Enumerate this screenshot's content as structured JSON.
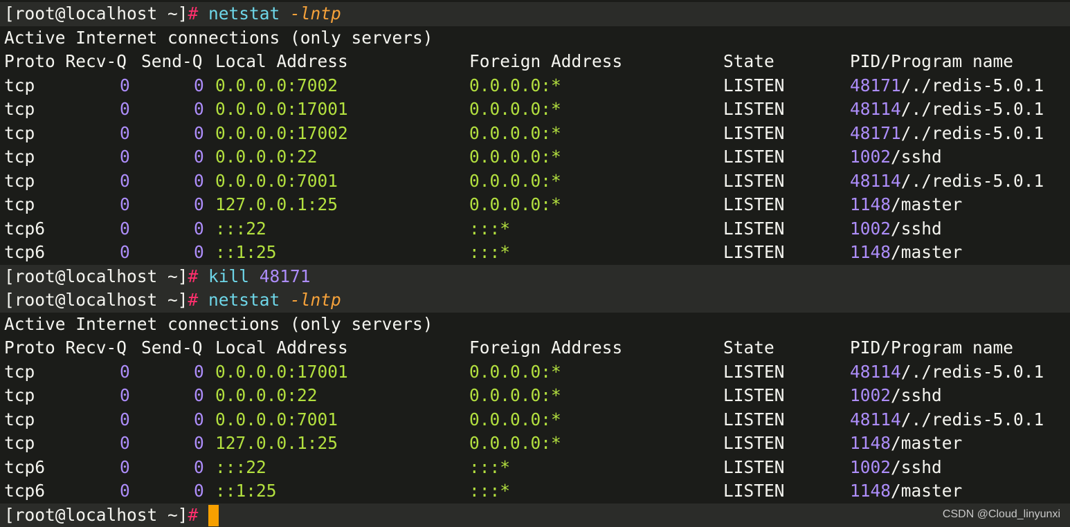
{
  "colors": {
    "background": "#1b1c19",
    "prompt_band": "#2b2c29",
    "text": "#f5f5f0",
    "number": "#ad8dfa",
    "address": "#b3e03f",
    "command": "#6ed6e8",
    "option": "#f6a23a",
    "prompt_hash": "#ff2f6d",
    "cursor": "#f7a000"
  },
  "prompt": {
    "text": "[root@localhost ~]",
    "symbol": "#"
  },
  "commands": [
    {
      "command": "netstat",
      "argument": "-lntp"
    },
    {
      "command": "kill",
      "argument": "48171"
    },
    {
      "command": "netstat",
      "argument": "-lntp"
    }
  ],
  "outputs": [
    {
      "heading": "Active Internet connections (only servers)",
      "columns": {
        "proto_recv": "Proto Recv-Q",
        "send": "Send-Q",
        "local": "Local Address",
        "foreign": "Foreign Address",
        "state": "State",
        "pid": "PID/Program name"
      },
      "rows": [
        {
          "proto": "tcp",
          "recv_q": "0",
          "send_q": "0",
          "local": "0.0.0.0:7002",
          "foreign": "0.0.0.0:*",
          "state": "LISTEN",
          "pid": "48171",
          "program": "/./redis-5.0.1"
        },
        {
          "proto": "tcp",
          "recv_q": "0",
          "send_q": "0",
          "local": "0.0.0.0:17001",
          "foreign": "0.0.0.0:*",
          "state": "LISTEN",
          "pid": "48114",
          "program": "/./redis-5.0.1"
        },
        {
          "proto": "tcp",
          "recv_q": "0",
          "send_q": "0",
          "local": "0.0.0.0:17002",
          "foreign": "0.0.0.0:*",
          "state": "LISTEN",
          "pid": "48171",
          "program": "/./redis-5.0.1"
        },
        {
          "proto": "tcp",
          "recv_q": "0",
          "send_q": "0",
          "local": "0.0.0.0:22",
          "foreign": "0.0.0.0:*",
          "state": "LISTEN",
          "pid": "1002",
          "program": "/sshd"
        },
        {
          "proto": "tcp",
          "recv_q": "0",
          "send_q": "0",
          "local": "0.0.0.0:7001",
          "foreign": "0.0.0.0:*",
          "state": "LISTEN",
          "pid": "48114",
          "program": "/./redis-5.0.1"
        },
        {
          "proto": "tcp",
          "recv_q": "0",
          "send_q": "0",
          "local": "127.0.0.1:25",
          "foreign": "0.0.0.0:*",
          "state": "LISTEN",
          "pid": "1148",
          "program": "/master"
        },
        {
          "proto": "tcp6",
          "recv_q": "0",
          "send_q": "0",
          "local": ":::22",
          "foreign": ":::*",
          "state": "LISTEN",
          "pid": "1002",
          "program": "/sshd"
        },
        {
          "proto": "tcp6",
          "recv_q": "0",
          "send_q": "0",
          "local": "::1:25",
          "foreign": ":::*",
          "state": "LISTEN",
          "pid": "1148",
          "program": "/master"
        }
      ]
    },
    {
      "heading": "Active Internet connections (only servers)",
      "columns": {
        "proto_recv": "Proto Recv-Q",
        "send": "Send-Q",
        "local": "Local Address",
        "foreign": "Foreign Address",
        "state": "State",
        "pid": "PID/Program name"
      },
      "rows": [
        {
          "proto": "tcp",
          "recv_q": "0",
          "send_q": "0",
          "local": "0.0.0.0:17001",
          "foreign": "0.0.0.0:*",
          "state": "LISTEN",
          "pid": "48114",
          "program": "/./redis-5.0.1"
        },
        {
          "proto": "tcp",
          "recv_q": "0",
          "send_q": "0",
          "local": "0.0.0.0:22",
          "foreign": "0.0.0.0:*",
          "state": "LISTEN",
          "pid": "1002",
          "program": "/sshd"
        },
        {
          "proto": "tcp",
          "recv_q": "0",
          "send_q": "0",
          "local": "0.0.0.0:7001",
          "foreign": "0.0.0.0:*",
          "state": "LISTEN",
          "pid": "48114",
          "program": "/./redis-5.0.1"
        },
        {
          "proto": "tcp",
          "recv_q": "0",
          "send_q": "0",
          "local": "127.0.0.1:25",
          "foreign": "0.0.0.0:*",
          "state": "LISTEN",
          "pid": "1148",
          "program": "/master"
        },
        {
          "proto": "tcp6",
          "recv_q": "0",
          "send_q": "0",
          "local": ":::22",
          "foreign": ":::*",
          "state": "LISTEN",
          "pid": "1002",
          "program": "/sshd"
        },
        {
          "proto": "tcp6",
          "recv_q": "0",
          "send_q": "0",
          "local": "::1:25",
          "foreign": ":::*",
          "state": "LISTEN",
          "pid": "1148",
          "program": "/master"
        }
      ]
    }
  ],
  "watermark": "CSDN @Cloud_linyunxi"
}
